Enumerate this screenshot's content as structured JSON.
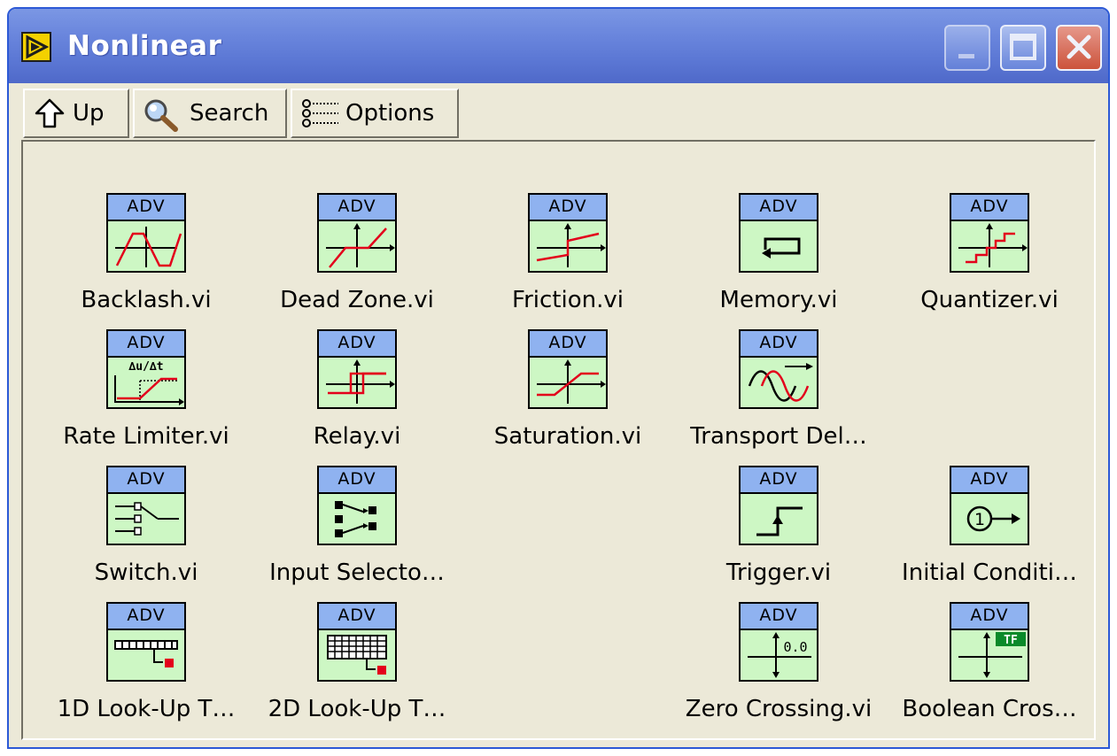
{
  "window": {
    "title": "Nonlinear",
    "title_color": "#ffffff",
    "titlebar_color": "#6a86dd"
  },
  "toolbar": {
    "up_label": "Up",
    "search_label": "Search",
    "options_label": "Options"
  },
  "icon_band_text": "ADV",
  "colors": {
    "icon_band": "#8fb2f0",
    "icon_body": "#cdf7c4",
    "plot_line": "#e3001b",
    "panel_bg": "#ece9d8"
  },
  "palette": {
    "items": [
      {
        "label": "Backlash.vi",
        "icon": "backlash-icon"
      },
      {
        "label": "Dead Zone.vi",
        "icon": "dead-zone-icon"
      },
      {
        "label": "Friction.vi",
        "icon": "friction-icon"
      },
      {
        "label": "Memory.vi",
        "icon": "memory-icon"
      },
      {
        "label": "Quantizer.vi",
        "icon": "quantizer-icon"
      },
      {
        "label": "Rate Limiter.vi",
        "icon": "rate-limiter-icon"
      },
      {
        "label": "Relay.vi",
        "icon": "relay-icon"
      },
      {
        "label": "Saturation.vi",
        "icon": "saturation-icon"
      },
      {
        "label": "Transport Del…",
        "icon": "transport-delay-icon"
      },
      {
        "label": "Switch.vi",
        "icon": "switch-icon"
      },
      {
        "label": "Input Selecto…",
        "icon": "input-selector-icon"
      },
      {
        "label": "Trigger.vi",
        "icon": "trigger-icon"
      },
      {
        "label": "Initial Conditi…",
        "icon": "initial-condition-icon"
      },
      {
        "label": "1D Look-Up T…",
        "icon": "lookup-1d-icon"
      },
      {
        "label": "2D Look-Up T…",
        "icon": "lookup-2d-icon"
      },
      {
        "label": "Zero Crossing.vi",
        "icon": "zero-crossing-icon"
      },
      {
        "label": "Boolean Cros…",
        "icon": "boolean-crossing-icon"
      }
    ],
    "initial_condition_text": "1",
    "zero_crossing_text": "0.0",
    "boolean_crossing_text": "TF"
  }
}
